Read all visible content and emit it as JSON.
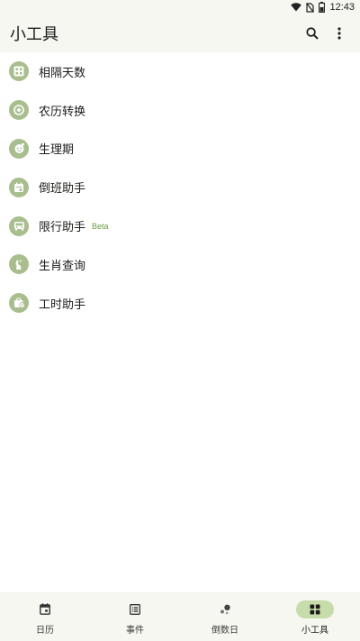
{
  "status_bar": {
    "time": "12:43",
    "icons": [
      "wifi-icon",
      "no-sim-icon",
      "battery-icon"
    ]
  },
  "app_bar": {
    "title": "小工具",
    "actions": [
      "search-icon",
      "more-vert-icon"
    ]
  },
  "tools": [
    {
      "label": "相隔天数",
      "icon": "grid-calculator-icon"
    },
    {
      "label": "农历转换",
      "icon": "lunar-convert-icon"
    },
    {
      "label": "生理期",
      "icon": "face-cycle-icon"
    },
    {
      "label": "倒班助手",
      "icon": "shift-calendar-icon"
    },
    {
      "label": "限行助手",
      "icon": "car-icon",
      "badge": "Beta"
    },
    {
      "label": "生肖查询",
      "icon": "zodiac-icon"
    },
    {
      "label": "工时助手",
      "icon": "work-hours-icon"
    }
  ],
  "bottom_nav": [
    {
      "label": "日历",
      "icon": "calendar-icon",
      "active": false
    },
    {
      "label": "事件",
      "icon": "list-icon",
      "active": false
    },
    {
      "label": "倒数日",
      "icon": "countdown-icon",
      "active": false
    },
    {
      "label": "小工具",
      "icon": "apps-grid-icon",
      "active": true
    }
  ],
  "colors": {
    "accent": "#a9be8e",
    "active_pill": "#c7dcab",
    "beta_badge": "#6d9b46",
    "bar_background": "#f5f7f0"
  }
}
